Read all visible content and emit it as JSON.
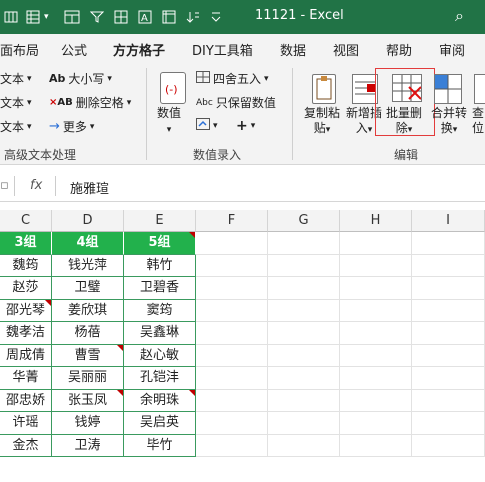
{
  "titlebar": {
    "title": "11121  -  Excel",
    "icons": [
      "spreadsheet-icon",
      "grid-icon",
      "filter-icon",
      "table-icon",
      "sheet-icon",
      "text-icon",
      "pivot-icon",
      "dropdown-icon",
      "search-icon"
    ]
  },
  "menu": {
    "tabs": [
      "面布局",
      "公式",
      "方方格子",
      "DIY工具箱",
      "数据",
      "视图",
      "帮助",
      "审阅"
    ],
    "active": "方方格子"
  },
  "ribbon": {
    "text_group": {
      "left_items": [
        "文本",
        "文本",
        "文本"
      ],
      "items": [
        "大小写",
        "删除空格",
        "更多"
      ],
      "label": "高级文本处理"
    },
    "number_group": {
      "big_button": "数值",
      "items": [
        "四舍五入",
        "只保留数值"
      ],
      "label": "数值录入"
    },
    "edit_group": {
      "buttons": [
        "复制粘贴",
        "新增插入",
        "批量删除",
        "合并转换",
        "查位"
      ],
      "button_lines": [
        [
          "复制粘",
          "贴"
        ],
        [
          "新增插",
          "入"
        ],
        [
          "批量删",
          "除"
        ],
        [
          "合并转",
          "换"
        ],
        [
          "查",
          "位"
        ]
      ],
      "label": "编辑"
    }
  },
  "formula_bar": {
    "fx": "fx",
    "value": "施雅瑄"
  },
  "grid": {
    "columns": [
      "C",
      "D",
      "E",
      "F",
      "G",
      "H",
      "I"
    ],
    "rows": [
      [
        "3组",
        "4组",
        "5组"
      ],
      [
        "魏筠",
        "钱光萍",
        "韩竹"
      ],
      [
        "赵莎",
        "卫璧",
        "卫碧香"
      ],
      [
        "邵光琴",
        "姜欣琪",
        "窦筠"
      ],
      [
        "魏孝洁",
        "杨蓓",
        "吴鑫琳"
      ],
      [
        "周成倩",
        "曹雪",
        "赵心敏"
      ],
      [
        "华菁",
        "吴丽丽",
        "孔铠沣"
      ],
      [
        "邵忠娇",
        "张玉凤",
        "余明珠"
      ],
      [
        "许瑶",
        "钱婷",
        "吴启英"
      ],
      [
        "金杰",
        "卫涛",
        "毕竹"
      ]
    ],
    "comment_marks": [
      [
        0,
        2
      ],
      [
        3,
        0
      ],
      [
        5,
        1
      ],
      [
        7,
        1
      ],
      [
        7,
        2
      ]
    ]
  }
}
